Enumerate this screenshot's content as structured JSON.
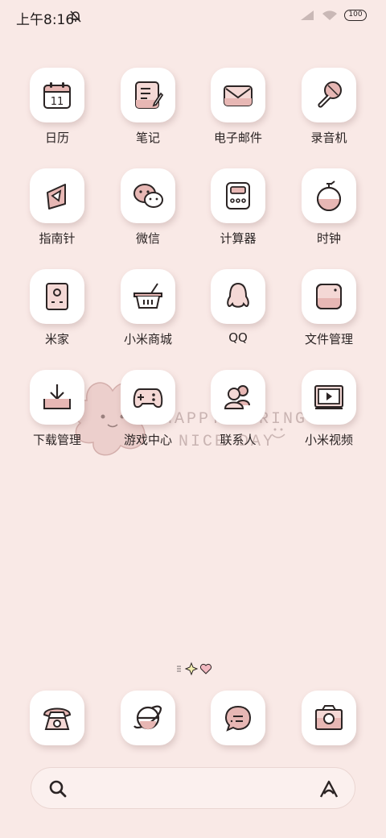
{
  "status_bar": {
    "time": "上午8:16",
    "battery": "100",
    "icons": [
      "bell-muted-icon",
      "signal-icon",
      "wifi-icon",
      "battery-icon"
    ]
  },
  "apps": [
    {
      "label": "日历",
      "icon": "calendar-icon",
      "calendar_day": "11"
    },
    {
      "label": "笔记",
      "icon": "notes-icon"
    },
    {
      "label": "电子邮件",
      "icon": "mail-icon"
    },
    {
      "label": "录音机",
      "icon": "microphone-icon"
    },
    {
      "label": "指南针",
      "icon": "compass-icon"
    },
    {
      "label": "微信",
      "icon": "wechat-icon"
    },
    {
      "label": "计算器",
      "icon": "calculator-icon"
    },
    {
      "label": "时钟",
      "icon": "clock-icon"
    },
    {
      "label": "米家",
      "icon": "mijia-icon"
    },
    {
      "label": "小米商城",
      "icon": "basket-icon"
    },
    {
      "label": "QQ",
      "icon": "qq-penguin-icon"
    },
    {
      "label": "文件管理",
      "icon": "folder-icon"
    },
    {
      "label": "下载管理",
      "icon": "download-icon"
    },
    {
      "label": "游戏中心",
      "icon": "gamepad-icon"
    },
    {
      "label": "联系人",
      "icon": "contacts-icon"
    },
    {
      "label": "小米视频",
      "icon": "video-icon"
    }
  ],
  "dock": [
    {
      "icon": "phone-icon"
    },
    {
      "icon": "browser-icon"
    },
    {
      "icon": "message-icon"
    },
    {
      "icon": "camera-icon"
    }
  ],
  "wallpaper_text": {
    "line1": "HAPPY SPRING",
    "line2": "NICE DAY"
  },
  "colors": {
    "background": "#f9e9e6",
    "accent_pink": "#e7b7b4",
    "stroke": "#2b2424"
  }
}
